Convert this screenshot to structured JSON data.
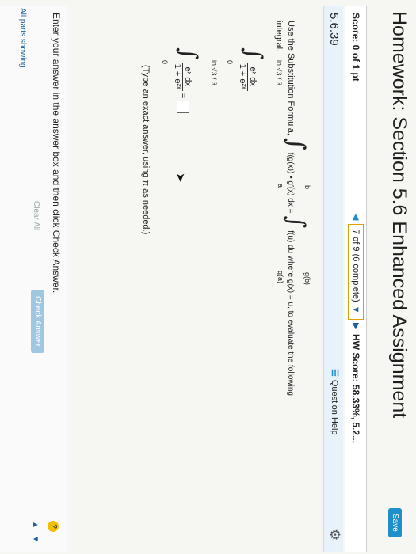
{
  "header": {
    "title": "Homework: Section 5.6 Enhanced Assignment",
    "save_label": "Save"
  },
  "scorebar": {
    "score": "Score: 0 of 1 pt",
    "progress": "7 of 9 (6 complete)",
    "hw_score": "HW Score: 58.33%, 5.2..."
  },
  "question": {
    "number": "5.6.39",
    "help_label": "Question Help"
  },
  "content": {
    "instruction_prefix": "Use the Substitution Formula,",
    "formula_left": "f(g(x)) • g′(x) dx =",
    "formula_right": "f(u) du where g(x) = u, to evaluate the following",
    "instruction_end": "integral.",
    "upper_b": "b",
    "lower_a": "a",
    "upper_gb": "g(b)",
    "lower_ga": "g(a)",
    "expr_upper": "ln √3 / 3",
    "expr_lower": "0",
    "numerator": "eˣ dx",
    "denominator": "1 + e²ˣ",
    "equals": "=",
    "hint": "(Type an exact answer, using π as needed.)"
  },
  "footer": {
    "message": "Enter your answer in the answer box and then click Check Answer.",
    "all_parts": "All parts showing",
    "clear_all": "Clear All",
    "check_answer": "Check Answer",
    "help": "?"
  }
}
